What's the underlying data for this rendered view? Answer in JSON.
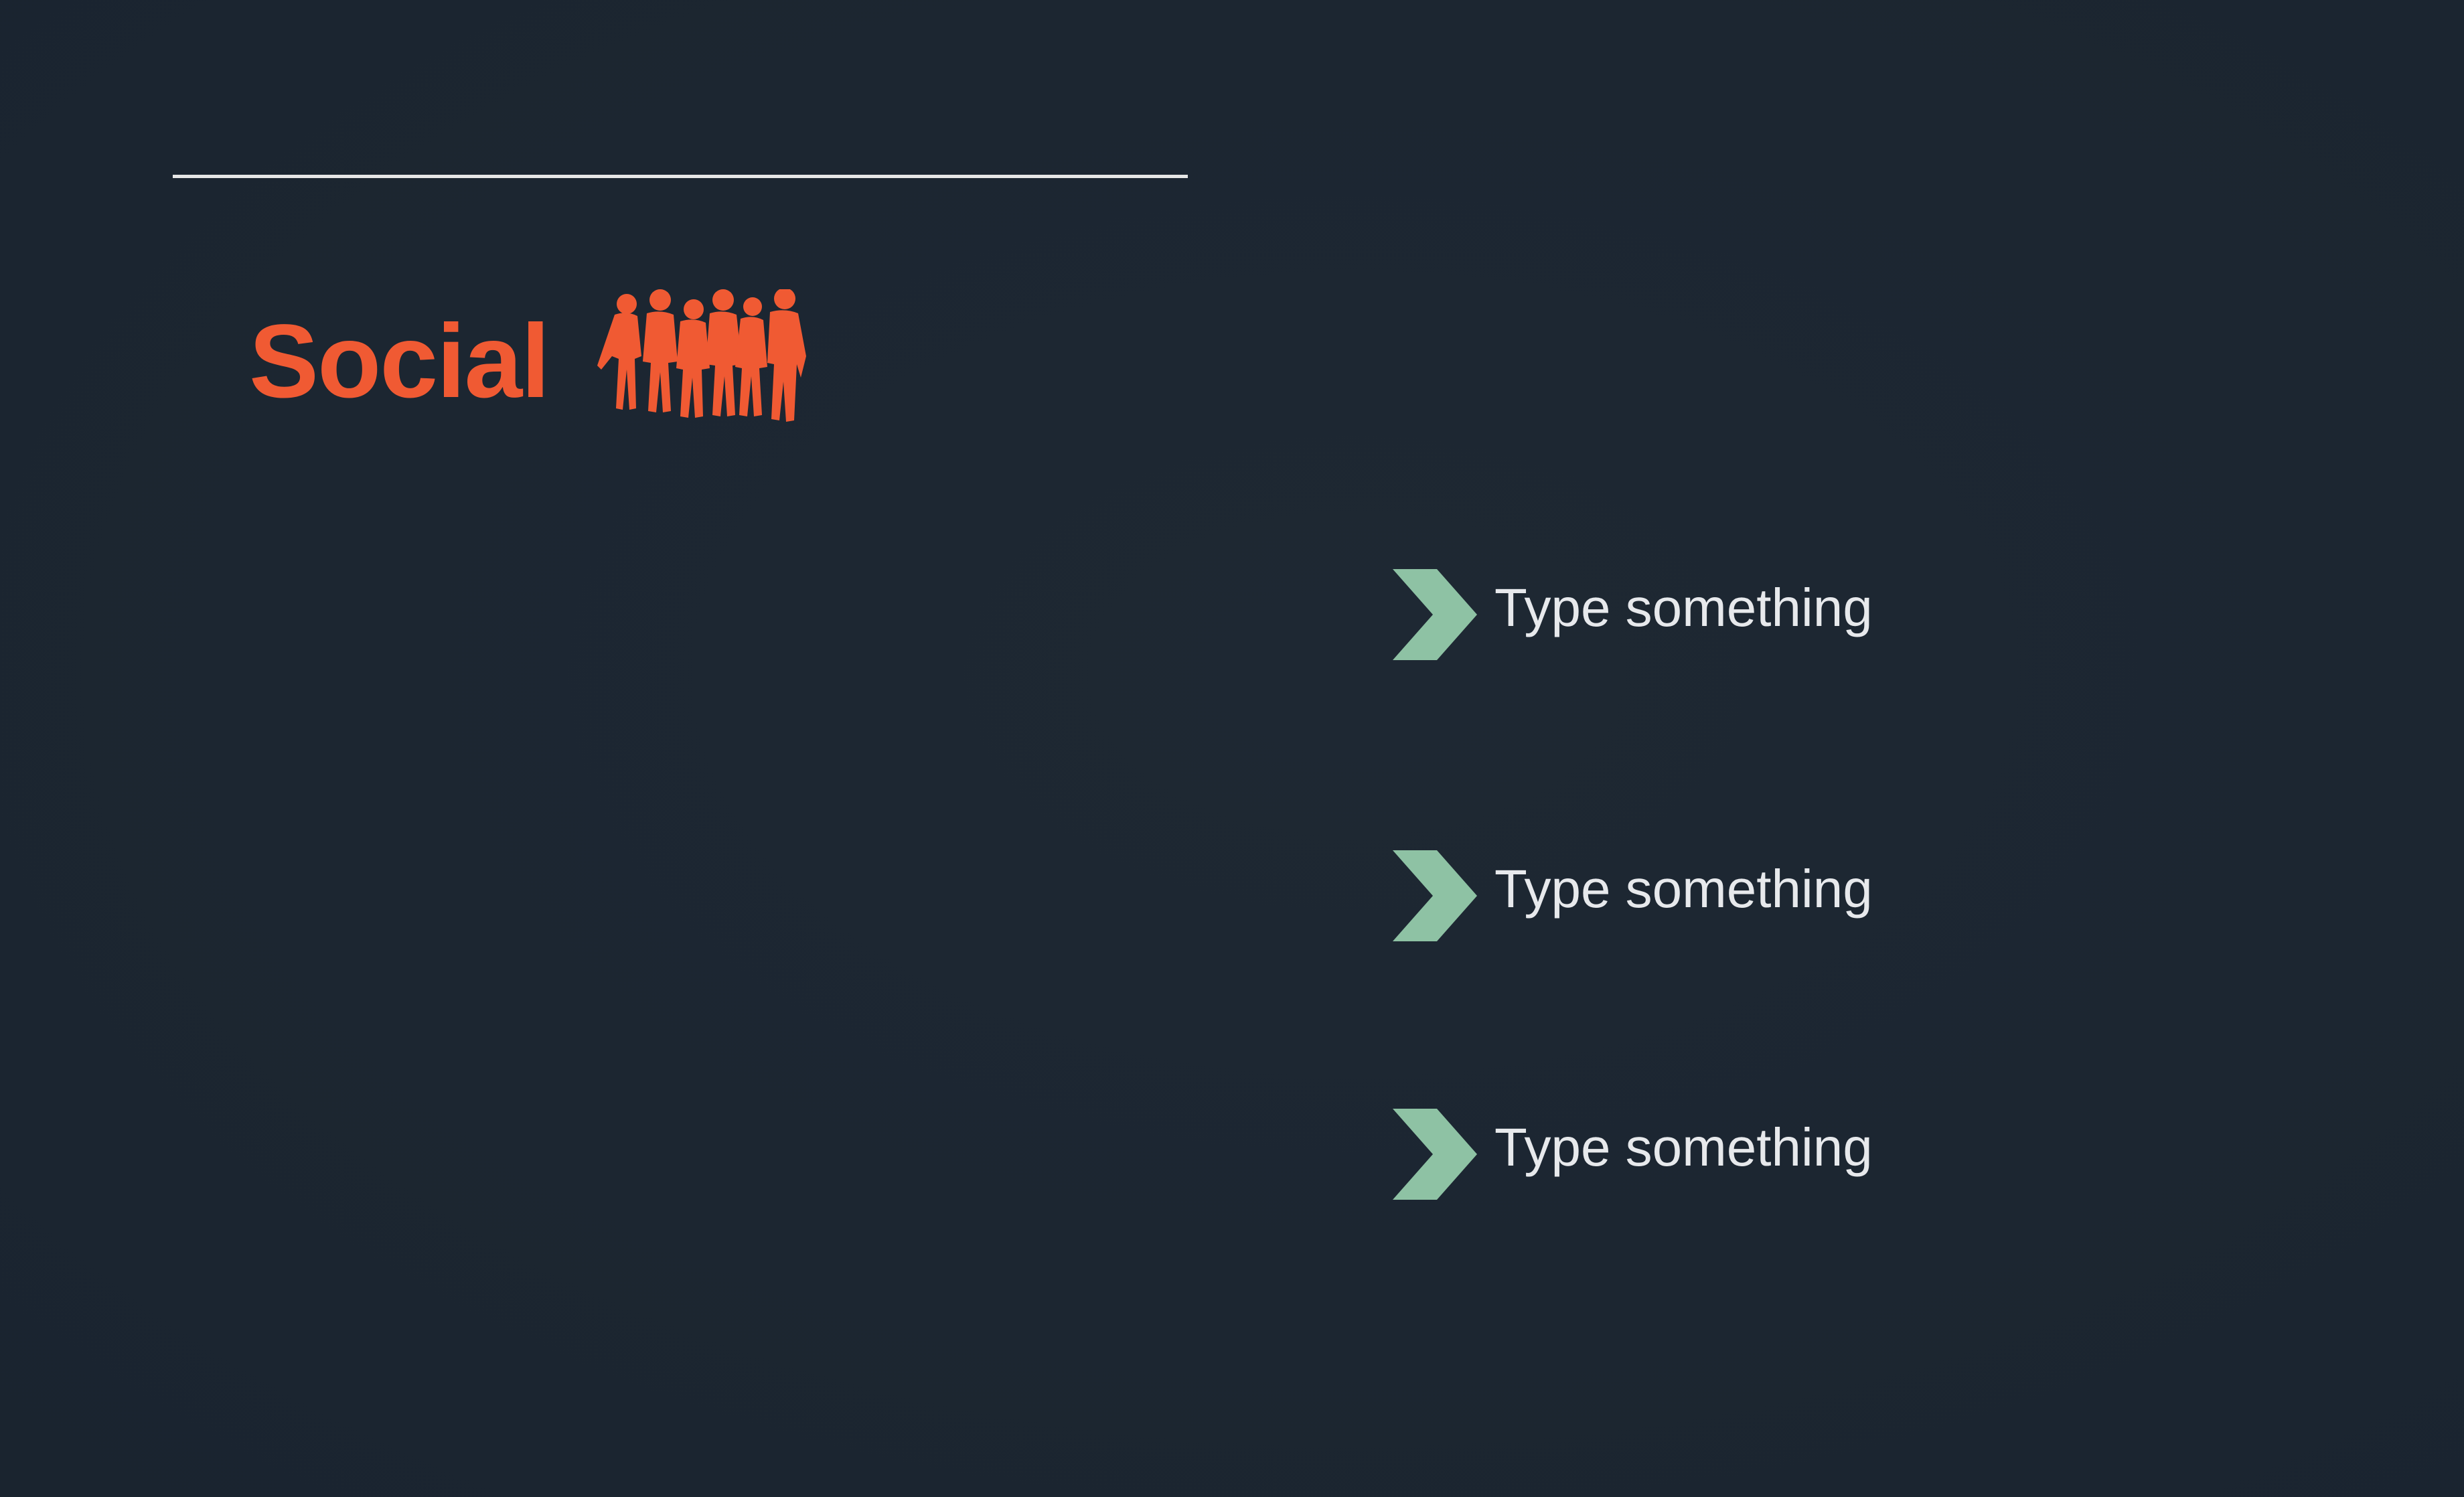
{
  "slide": {
    "title": "Social",
    "title_icon": "group-of-people-icon",
    "bullets": [
      {
        "icon": "chevron-right-icon",
        "text": "Type something"
      },
      {
        "icon": "chevron-right-icon",
        "text": "Type something"
      },
      {
        "icon": "chevron-right-icon",
        "text": "Type something"
      }
    ]
  },
  "colors": {
    "background": "#1c2631",
    "accent": "#f05a33",
    "chevron": "#8ec2a4",
    "text": "#e7e9ec",
    "rule": "#e6e6e6"
  }
}
